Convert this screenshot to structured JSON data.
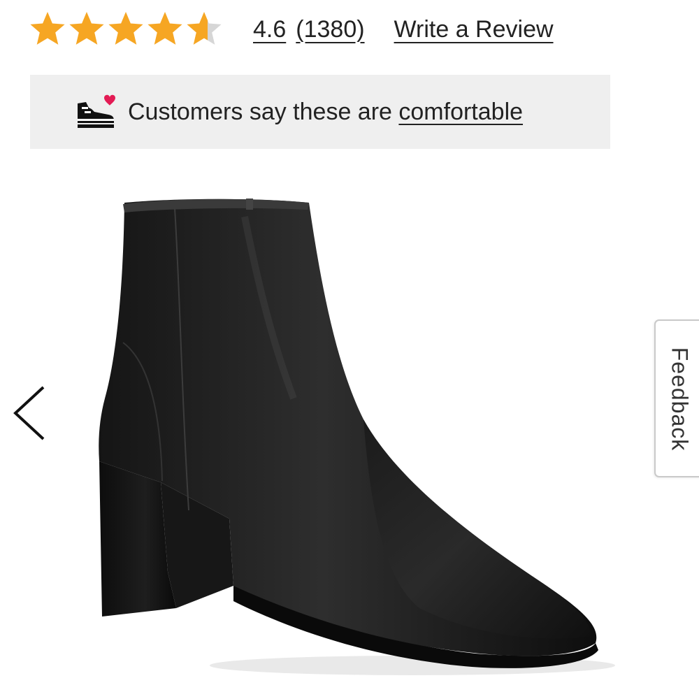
{
  "rating": {
    "value": "4.6",
    "count": "(1380)",
    "stars_filled": 4.6,
    "stars_total": 5,
    "write_review_label": "Write a Review"
  },
  "comfort_banner": {
    "text_prefix": "Customers say these are ",
    "link_text": "comfortable",
    "icon": "sneaker-heart-icon"
  },
  "gallery": {
    "prev_icon": "chevron-left-icon",
    "image_alt": "Black leather ankle boot"
  },
  "feedback_tab": {
    "label": "Feedback"
  },
  "colors": {
    "star_fill": "#f6a623",
    "star_empty": "#d6d6d6",
    "heart": "#e31b54",
    "banner_bg": "#efefef"
  }
}
